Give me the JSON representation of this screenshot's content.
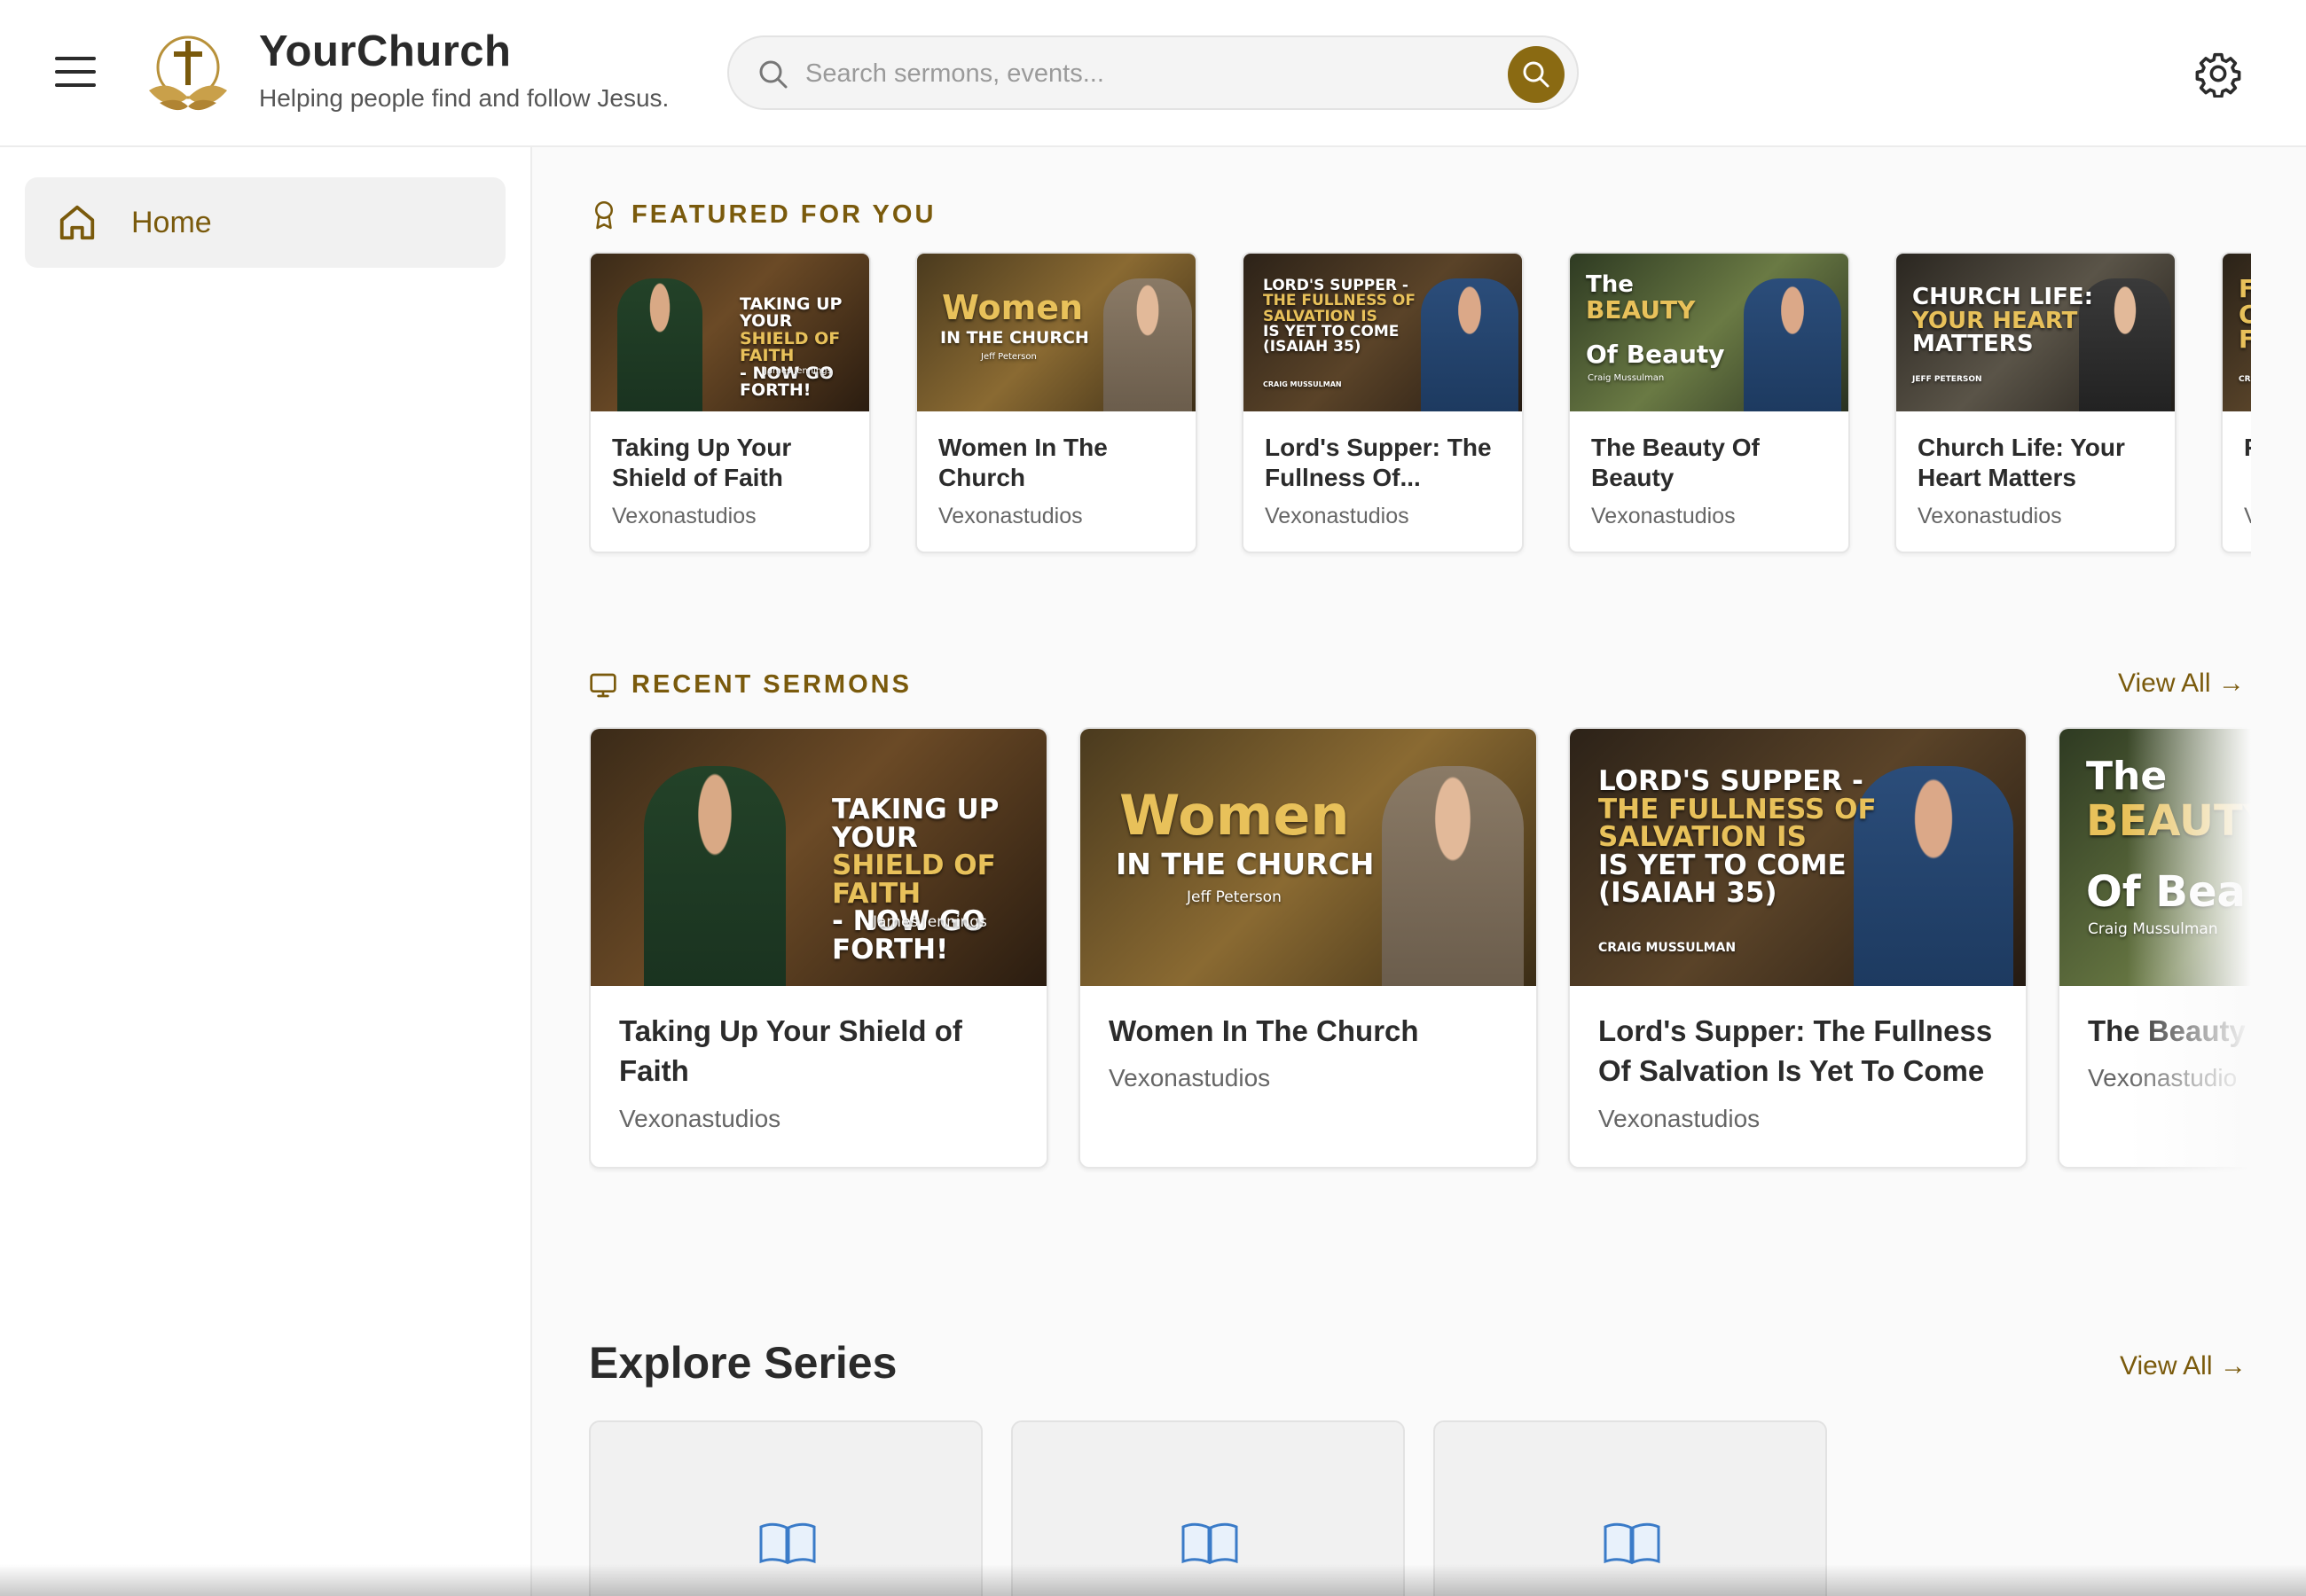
{
  "header": {
    "brand_name": "YourChurch",
    "brand_tagline": "Helping people find and follow Jesus.",
    "search_placeholder": "Search sermons, events...",
    "accent_color": "#8a6a12"
  },
  "sidebar": {
    "items": [
      {
        "label": "Home",
        "icon": "home-icon",
        "active": true
      }
    ]
  },
  "featured": {
    "title": "FEATURED FOR YOU",
    "icon": "award-icon",
    "cards": [
      {
        "title": "Taking Up Your Shield of Faith",
        "author": "Vexonastudios",
        "thumb_lines": [
          "TAKING UP YOUR",
          "SHIELD OF FAITH",
          "- NOW GO FORTH!"
        ],
        "thumb_sub": "James Jennings"
      },
      {
        "title": "Women In The Church",
        "author": "Vexonastudios",
        "thumb_lines": [
          "Women",
          "IN THE CHURCH"
        ],
        "thumb_sub": "Jeff Peterson"
      },
      {
        "title": "Lord's Supper: The Fullness Of...",
        "author": "Vexonastudios",
        "thumb_lines": [
          "LORD'S SUPPER -",
          "THE FULLNESS OF",
          "SALVATION IS",
          "IS YET TO COME",
          "(ISAIAH 35)"
        ],
        "thumb_sub": "CRAIG MUSSULMAN"
      },
      {
        "title": "The Beauty Of Beauty",
        "author": "Vexonastudios",
        "thumb_lines": [
          "The",
          "BEAUTY",
          "Of Beauty"
        ],
        "thumb_sub": "Craig Mussulman"
      },
      {
        "title": "Church Life: Your Heart Matters",
        "author": "Vexonastudios",
        "thumb_lines": [
          "CHURCH LIFE:",
          "YOUR HEART",
          "MATTERS"
        ],
        "thumb_sub": "JEFF PETERSON"
      },
      {
        "title": "F C",
        "author": "V",
        "thumb_lines": [
          "F",
          "C",
          "F"
        ],
        "thumb_sub": "Cr"
      }
    ]
  },
  "recent": {
    "title": "RECENT SERMONS",
    "icon": "monitor-icon",
    "view_all": "View All →",
    "cards": [
      {
        "title": "Taking Up Your Shield of Faith",
        "author": "Vexonastudios"
      },
      {
        "title": "Women In The Church",
        "author": "Vexonastudios"
      },
      {
        "title": "Lord's Supper: The Fullness Of Salvation Is Yet To Come",
        "author": "Vexonastudios"
      },
      {
        "title": "The Beauty",
        "author": "Vexonastudio"
      }
    ]
  },
  "explore": {
    "title": "Explore Series",
    "view_all": "View All →",
    "series_icon": "book-icon",
    "series_count": 3
  }
}
